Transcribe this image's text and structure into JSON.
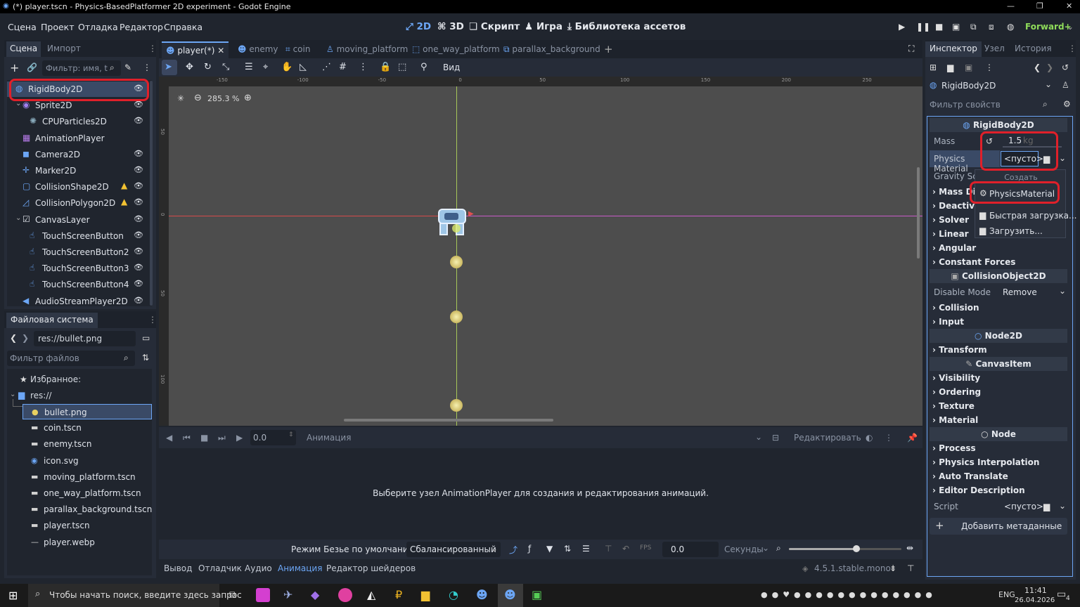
{
  "window": {
    "title": "(*) player.tscn - Physics-BasedPlatformer 2D experiment - Godot Engine",
    "controls": [
      "—",
      "❐",
      "✕"
    ]
  },
  "menu": {
    "items": [
      "Сцена",
      "Проект",
      "Отладка",
      "Редактор",
      "Справка"
    ],
    "workspaces": [
      "2D",
      "3D",
      "Скрипт",
      "Игра",
      "Библиотека ассетов"
    ],
    "renderer": "Forward+"
  },
  "scene_dock": {
    "tabs": [
      "Сцена",
      "Импорт"
    ],
    "filter_placeholder": "Фильтр: имя, t",
    "nodes": [
      {
        "label": "RigidBody2D",
        "icon": "rigidbody-icon",
        "depth": 0,
        "eye": true,
        "warn": false,
        "selected": true
      },
      {
        "label": "Sprite2D",
        "icon": "sprite-icon",
        "depth": 1,
        "eye": true,
        "warn": false,
        "selected": false
      },
      {
        "label": "CPUParticles2D",
        "icon": "particles-icon",
        "depth": 2,
        "eye": true,
        "warn": false,
        "selected": false
      },
      {
        "label": "AnimationPlayer",
        "icon": "animation-icon",
        "depth": 1,
        "eye": false,
        "warn": false,
        "selected": false
      },
      {
        "label": "Camera2D",
        "icon": "camera-icon",
        "depth": 1,
        "eye": true,
        "warn": false,
        "selected": false
      },
      {
        "label": "Marker2D",
        "icon": "marker-icon",
        "depth": 1,
        "eye": true,
        "warn": false,
        "selected": false
      },
      {
        "label": "CollisionShape2D",
        "icon": "collision-shape-icon",
        "depth": 1,
        "eye": true,
        "warn": true,
        "selected": false
      },
      {
        "label": "CollisionPolygon2D",
        "icon": "collision-polygon-icon",
        "depth": 1,
        "eye": true,
        "warn": true,
        "selected": false
      },
      {
        "label": "CanvasLayer",
        "icon": "canvas-layer-icon",
        "depth": 1,
        "eye": true,
        "warn": false,
        "selected": false
      },
      {
        "label": "TouchScreenButton",
        "icon": "touch-button-icon",
        "depth": 2,
        "eye": true,
        "warn": false,
        "selected": false
      },
      {
        "label": "TouchScreenButton2",
        "icon": "touch-button-icon",
        "depth": 2,
        "eye": true,
        "warn": false,
        "selected": false
      },
      {
        "label": "TouchScreenButton3",
        "icon": "touch-button-icon",
        "depth": 2,
        "eye": true,
        "warn": false,
        "selected": false
      },
      {
        "label": "TouchScreenButton4",
        "icon": "touch-button-icon",
        "depth": 2,
        "eye": true,
        "warn": false,
        "selected": false
      },
      {
        "label": "AudioStreamPlayer2D",
        "icon": "audio-icon",
        "depth": 1,
        "eye": true,
        "warn": false,
        "selected": false
      }
    ]
  },
  "filesystem": {
    "title": "Файловая система",
    "path": "res://bullet.png",
    "filter_placeholder": "Фильтр файлов",
    "favorites_label": "Избранное:",
    "root_label": "res://",
    "files": [
      {
        "name": "bullet.png",
        "selected": true
      },
      {
        "name": "coin.tscn",
        "selected": false
      },
      {
        "name": "enemy.tscn",
        "selected": false
      },
      {
        "name": "icon.svg",
        "selected": false
      },
      {
        "name": "moving_platform.tscn",
        "selected": false
      },
      {
        "name": "one_way_platform.tscn",
        "selected": false
      },
      {
        "name": "parallax_background.tscn",
        "selected": false
      },
      {
        "name": "player.tscn",
        "selected": false
      },
      {
        "name": "player.webp",
        "selected": false
      }
    ]
  },
  "editor": {
    "scene_tabs": [
      "player(*)",
      "enemy",
      "coin",
      "moving_platform",
      "one_way_platform",
      "parallax_background"
    ],
    "view_label": "Вид",
    "zoom": "285.3 %",
    "ruler_labels": [
      "-150",
      "-100",
      "-50",
      "0",
      "50",
      "100",
      "150",
      "200",
      "250"
    ]
  },
  "animation_panel": {
    "time_value": "0.0",
    "animation_placeholder": "Анимация",
    "edit_label": "Редактировать",
    "message": "Выберите узел AnimationPlayer для создания и редактирования анимаций.",
    "bezier_label": "Режим Безье по умолчанию:",
    "bezier_value": "Сбалансированный",
    "step_value": "0.0",
    "unit_value": "Секунды",
    "zoom_fraction": 0.6
  },
  "bottom_tabs": [
    "Вывод",
    "Отладчик",
    "Аудио",
    "Анимация",
    "Редактор шейдеров"
  ],
  "version": "4.5.1.stable.mono",
  "inspector": {
    "tabs": [
      "Инспектор",
      "Узел",
      "История"
    ],
    "node_name": "RigidBody2D",
    "filter_placeholder": "Фильтр свойств",
    "header": "RigidBody2D",
    "mass_label": "Mass",
    "mass_value": "1.5",
    "mass_unit": "kg",
    "physics_material_label": "Physics Material",
    "physics_material_value": "<пусто>",
    "gravity_label": "Gravity Sca",
    "mass_dist_label": "Mass Dist",
    "deactivation_label": "Deactivat",
    "dropdown": {
      "header": "Создать",
      "items": [
        "PhysicsMaterial",
        "Быстрая загрузка...",
        "Загрузить..."
      ]
    },
    "categories_rb": [
      "Solver",
      "Linear",
      "Angular",
      "Constant Forces"
    ],
    "section_collision": "CollisionObject2D",
    "disable_mode_label": "Disable Mode",
    "disable_mode_value": "Remove",
    "categories_co": [
      "Collision",
      "Input"
    ],
    "section_node2d": "Node2D",
    "categories_n2d": [
      "Transform"
    ],
    "section_canvas": "CanvasItem",
    "categories_ci": [
      "Visibility",
      "Ordering",
      "Texture",
      "Material"
    ],
    "section_node": "Node",
    "categories_node": [
      "Process",
      "Physics Interpolation",
      "Auto Translate",
      "Editor Description"
    ],
    "script_label": "Script",
    "script_value": "<пусто>",
    "add_metadata": "Добавить метаданные"
  },
  "taskbar": {
    "search_placeholder": "Чтобы начать поиск, введите здесь запрос",
    "language": "ENG",
    "time": "11:41",
    "date": "26.04.2026",
    "notif_count": "4"
  },
  "colors": {
    "accent": "#6ca6f5",
    "highlight_red": "#e0202a",
    "viewport_bg": "#4d4d4d"
  }
}
